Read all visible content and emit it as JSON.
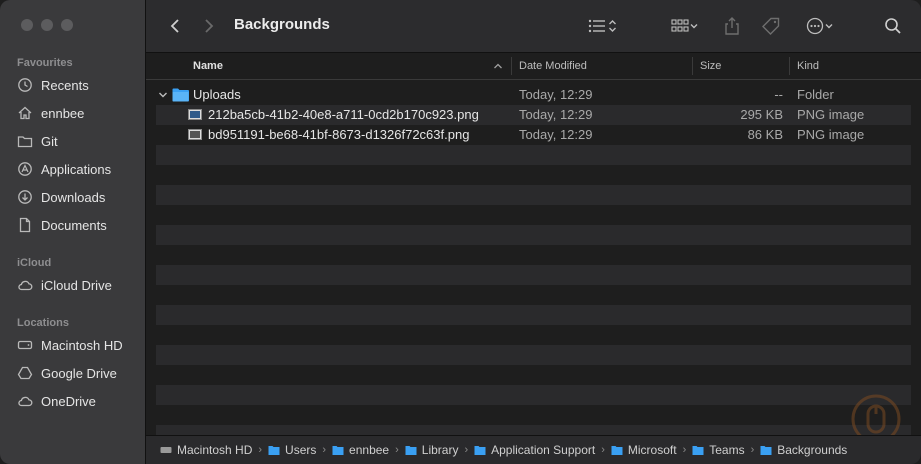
{
  "window": {
    "title": "Backgrounds"
  },
  "sidebar": {
    "sections": [
      {
        "label": "Favourites",
        "items": [
          {
            "label": "Recents",
            "icon": "clock-icon"
          },
          {
            "label": "ennbee",
            "icon": "home-icon"
          },
          {
            "label": "Git",
            "icon": "folder-icon"
          },
          {
            "label": "Applications",
            "icon": "applications-icon"
          },
          {
            "label": "Downloads",
            "icon": "download-icon"
          },
          {
            "label": "Documents",
            "icon": "document-icon"
          }
        ]
      },
      {
        "label": "iCloud",
        "items": [
          {
            "label": "iCloud Drive",
            "icon": "cloud-icon"
          }
        ]
      },
      {
        "label": "Locations",
        "items": [
          {
            "label": "Macintosh HD",
            "icon": "disk-icon"
          },
          {
            "label": "Google Drive",
            "icon": "drive-icon"
          },
          {
            "label": "OneDrive",
            "icon": "cloud-icon"
          }
        ]
      }
    ]
  },
  "columns": {
    "name": "Name",
    "date": "Date Modified",
    "size": "Size",
    "kind": "Kind"
  },
  "files": [
    {
      "name": "Uploads",
      "date": "Today, 12:29",
      "size": "--",
      "kind": "Folder",
      "icon": "folder-icon"
    },
    {
      "name": "212ba5cb-41b2-40e8-a711-0cd2b170c923.png",
      "date": "Today, 12:29",
      "size": "295 KB",
      "kind": "PNG image",
      "icon": "image-file-icon"
    },
    {
      "name": "bd951191-be68-41bf-8673-d1326f72c63f.png",
      "date": "Today, 12:29",
      "size": "86 KB",
      "kind": "PNG image",
      "icon": "image-file-icon"
    }
  ],
  "pathbar": [
    {
      "label": "Macintosh HD",
      "icon": "disk-icon"
    },
    {
      "label": "Users",
      "icon": "folder-icon"
    },
    {
      "label": "ennbee",
      "icon": "folder-icon"
    },
    {
      "label": "Library",
      "icon": "folder-icon"
    },
    {
      "label": "Application Support",
      "icon": "folder-icon"
    },
    {
      "label": "Microsoft",
      "icon": "folder-icon"
    },
    {
      "label": "Teams",
      "icon": "folder-icon"
    },
    {
      "label": "Backgrounds",
      "icon": "folder-icon"
    }
  ],
  "colors": {
    "accent": "#3aa0f3",
    "sidebar_bg": "#3a3a3c",
    "content_bg": "#1e1e1e"
  }
}
